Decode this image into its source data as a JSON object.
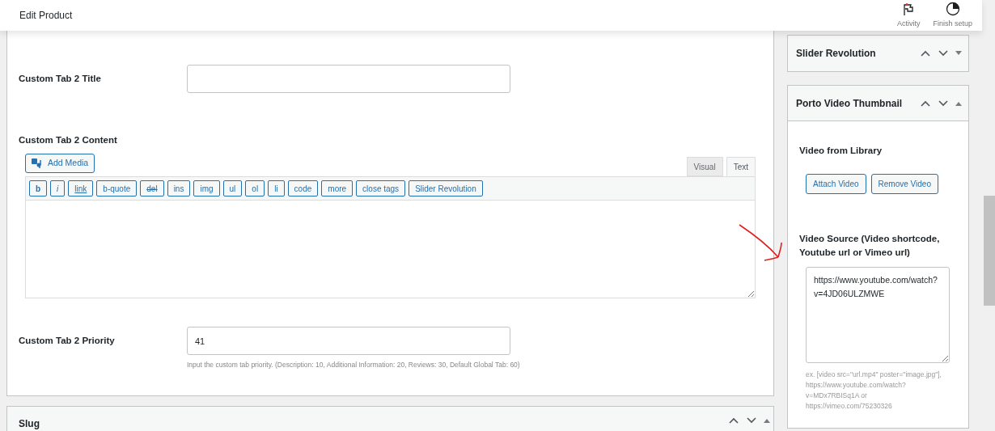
{
  "header": {
    "title": "Edit Product",
    "actions": [
      {
        "kind": "flag",
        "label": "Activity"
      },
      {
        "kind": "progress",
        "label": "Finish setup"
      }
    ]
  },
  "main_panel": {
    "title_field": {
      "label": "Custom Tab 2 Title"
    },
    "content_field": {
      "label": "Custom Tab 2 Content",
      "add_media": "Add Media",
      "tabs": [
        {
          "label": "Visual",
          "selected": false
        },
        {
          "label": "Text",
          "selected": true
        }
      ],
      "toolbar": [
        {
          "label": "b",
          "kind": "bold"
        },
        {
          "label": "i",
          "kind": "italic"
        },
        {
          "label": "link",
          "kind": "underline"
        },
        {
          "label": "b-quote",
          "kind": "plain"
        },
        {
          "label": "del",
          "kind": "strike"
        },
        {
          "label": "ins",
          "kind": "plain"
        },
        {
          "label": "img",
          "kind": "plain"
        },
        {
          "label": "ul",
          "kind": "plain"
        },
        {
          "label": "ol",
          "kind": "plain"
        },
        {
          "label": "li",
          "kind": "plain"
        },
        {
          "label": "code",
          "kind": "plain"
        },
        {
          "label": "more",
          "kind": "plain"
        },
        {
          "label": "close tags",
          "kind": "plain"
        },
        {
          "label": "Slider Revolution",
          "kind": "plain"
        }
      ]
    },
    "priority_field": {
      "label": "Custom Tab 2 Priority",
      "value": "41",
      "note": "Input the custom tab priority. (Description: 10, Additional Information: 20, Reviews: 30, Default Global Tab: 60)"
    }
  },
  "slug_panel": {
    "title": "Slug",
    "expanded": true
  },
  "sidebar": [
    {
      "title": "Slider Revolution",
      "expanded": false
    },
    {
      "title": "Porto Video Thumbnail",
      "expanded": true,
      "library_label": "Video from Library",
      "buttons": [
        "Attach Video",
        "Remove Video"
      ],
      "source_label": "Video Source (Video shortcode, Youtube url or Vimeo url)",
      "source_value": "https://www.youtube.com/watch?v=4JD06ULZMWE",
      "example": "ex. [video src=\"url.mp4\" poster=\"image.jpg\"], https://www.youtube.com/watch?v=MDx7RBISq1A or https://vimeo.com/75230326"
    }
  ]
}
